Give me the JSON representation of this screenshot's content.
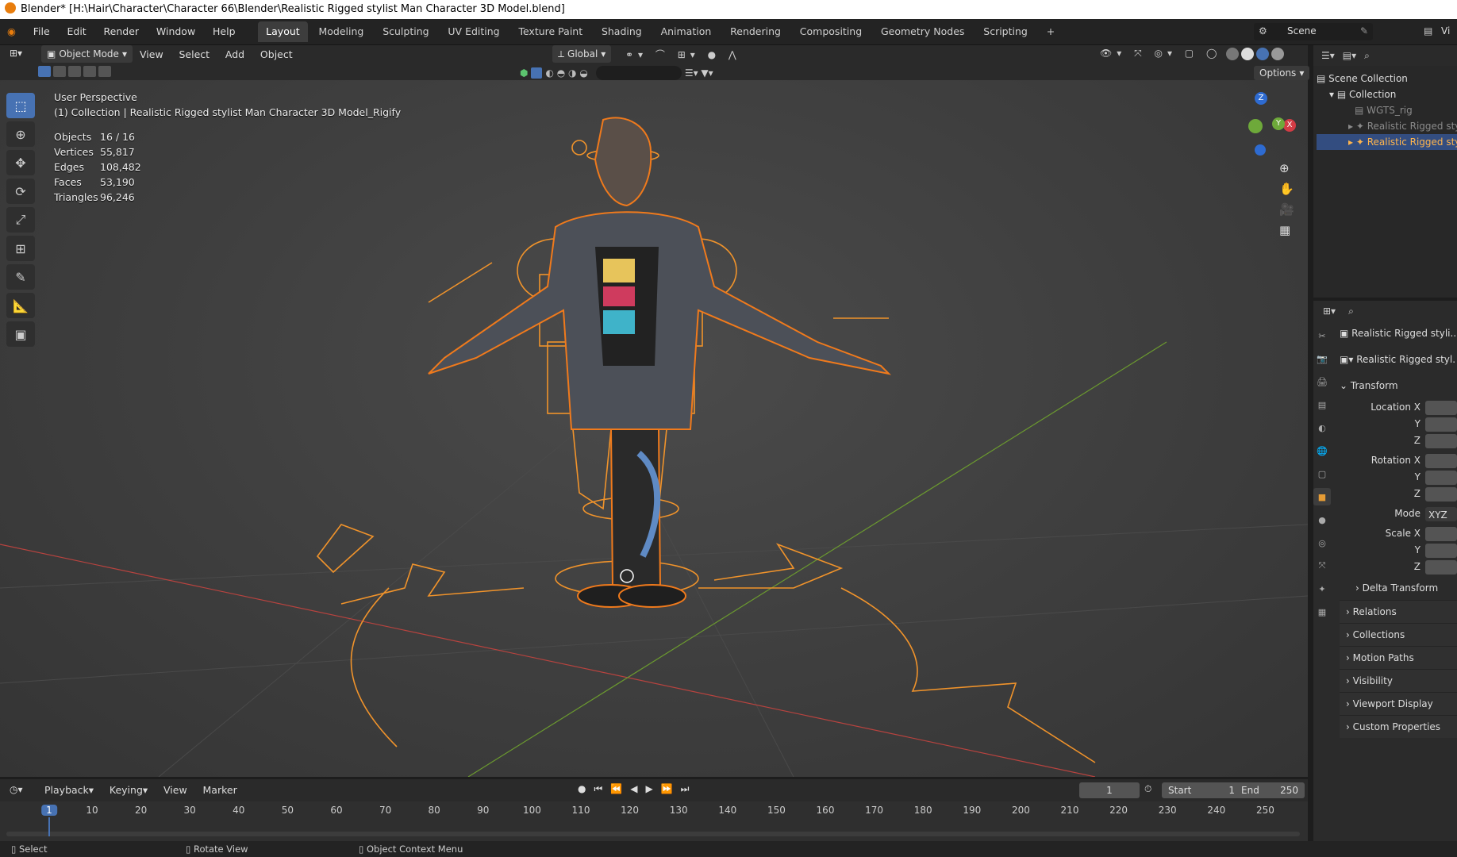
{
  "window": {
    "title": "Blender* [H:\\Hair\\Character\\Character 66\\Blender\\Realistic Rigged stylist Man Character 3D Model.blend]"
  },
  "menu": [
    "File",
    "Edit",
    "Render",
    "Window",
    "Help"
  ],
  "workspaces": [
    "Layout",
    "Modeling",
    "Sculpting",
    "UV Editing",
    "Texture Paint",
    "Shading",
    "Animation",
    "Rendering",
    "Compositing",
    "Geometry Nodes",
    "Scripting"
  ],
  "scene": {
    "name": "Scene",
    "view_layer": "Vi"
  },
  "viewport_header": {
    "mode": "Object Mode",
    "menus": [
      "View",
      "Select",
      "Add",
      "Object"
    ],
    "orientation": "Global",
    "options": "Options"
  },
  "overlay": {
    "perspective": "User Perspective",
    "collection_line": "(1) Collection | Realistic Rigged stylist Man Character 3D Model_Rigify",
    "stats": [
      {
        "k": "Objects",
        "v": "16 / 16"
      },
      {
        "k": "Vertices",
        "v": "55,817"
      },
      {
        "k": "Edges",
        "v": "108,482"
      },
      {
        "k": "Faces",
        "v": "53,190"
      },
      {
        "k": "Triangles",
        "v": "96,246"
      }
    ]
  },
  "gizmo": {
    "z": "Z",
    "x": "X",
    "y": "Y"
  },
  "outliner": {
    "root": "Scene Collection",
    "collection": "Collection",
    "items": [
      "WGTS_rig",
      "Realistic Rigged sty",
      "Realistic Rigged sty"
    ]
  },
  "properties": {
    "object_name": "Realistic Rigged styli....a",
    "data_name": "Realistic Rigged styl.",
    "transform": "Transform",
    "location_x": "Location X",
    "y": "Y",
    "z": "Z",
    "rotation_x": "Rotation X",
    "mode_label": "Mode",
    "mode_value": "XYZ",
    "scale_x": "Scale X",
    "delta": "Delta Transform",
    "panels": [
      "Relations",
      "Collections",
      "Motion Paths",
      "Visibility",
      "Viewport Display",
      "Custom Properties"
    ]
  },
  "timeline": {
    "menus": [
      "Playback",
      "Keying",
      "View",
      "Marker"
    ],
    "current_frame": "1",
    "start_label": "Start",
    "start": "1",
    "end_label": "End",
    "end": "250",
    "ticks": [
      "1",
      "10",
      "20",
      "30",
      "40",
      "50",
      "60",
      "70",
      "80",
      "90",
      "100",
      "110",
      "120",
      "130",
      "140",
      "150",
      "160",
      "170",
      "180",
      "190",
      "200",
      "210",
      "220",
      "230",
      "240",
      "250"
    ]
  },
  "status": {
    "select": "Select",
    "rotate": "Rotate View",
    "context": "Object Context Menu"
  },
  "colors": {
    "accent": "#4772b3",
    "selection": "#e87d0d",
    "active_text": "#ffb54d"
  }
}
